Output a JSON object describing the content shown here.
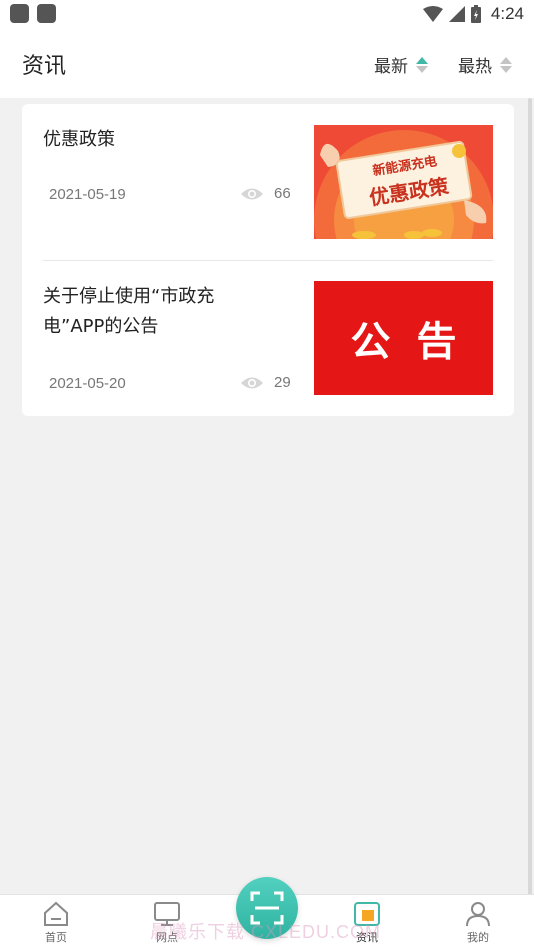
{
  "status_bar": {
    "time": "4:24"
  },
  "header": {
    "title": "资讯",
    "sort_latest": "最新",
    "sort_hot": "最热",
    "accent_color": "#3fb9a6"
  },
  "news": [
    {
      "title": "优惠政策",
      "date": "2021-05-19",
      "views": "66",
      "thumb_line1": "新能源充电",
      "thumb_line2": "优惠政策"
    },
    {
      "title": "关于停止使用“市政充电”APP的公告",
      "date": "2021-05-20",
      "views": "29",
      "thumb_text": "公告"
    }
  ],
  "tabbar": {
    "home": "首页",
    "stations": "网点",
    "news": "资讯",
    "mine": "我的"
  },
  "watermark": "晨曦乐下载 CXLEDU.COM"
}
